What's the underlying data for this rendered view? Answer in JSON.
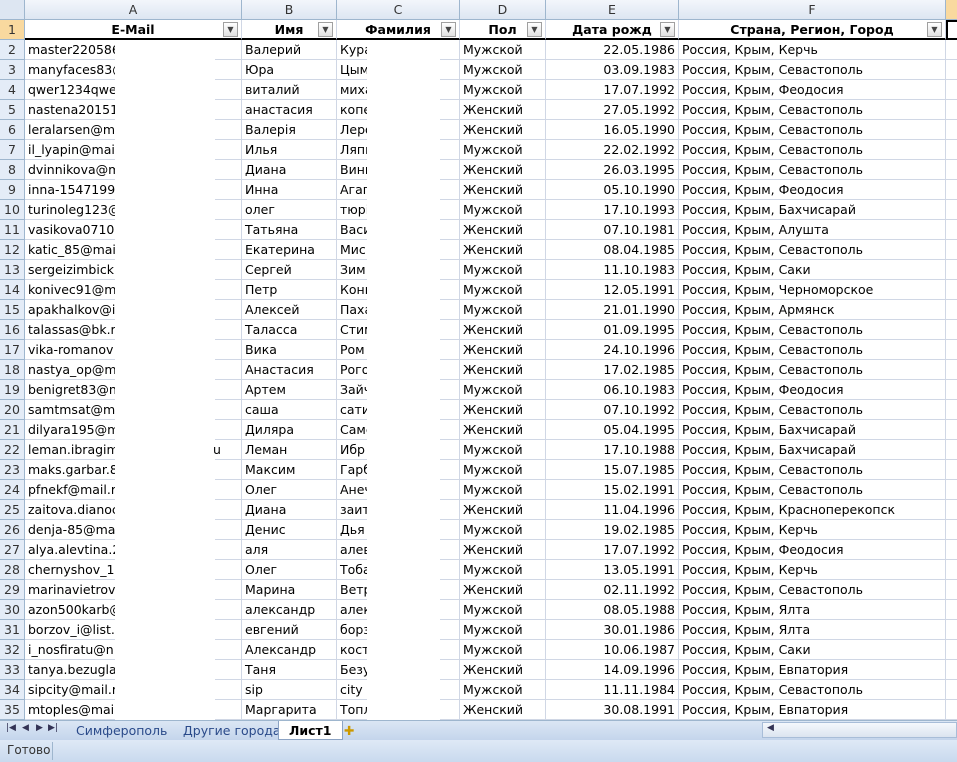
{
  "columns": [
    "A",
    "B",
    "C",
    "D",
    "E",
    "F"
  ],
  "headers": {
    "email": "E-Mail",
    "name": "Имя",
    "surname": "Фамилия",
    "gender": "Пол",
    "birth": "Дата рожд",
    "location": "Страна, Регион, Город"
  },
  "rows": [
    [
      "2",
      "master220586",
      "Валерий",
      "Кура",
      "Мужской",
      "22.05.1986",
      "Россия, Крым, Керчь"
    ],
    [
      "3",
      "manyfaces83@",
      "Юра",
      "Цым",
      "Мужской",
      "03.09.1983",
      "Россия, Крым, Севастополь"
    ],
    [
      "4",
      "qwer1234qwe",
      "виталий",
      "миха",
      "Мужской",
      "17.07.1992",
      "Россия, Крым, Феодосия"
    ],
    [
      "5",
      "nastena20151",
      "анастасия",
      "копе",
      "Женский",
      "27.05.1992",
      "Россия, Крым, Севастополь"
    ],
    [
      "6",
      "leralarsen@m",
      "Валерія",
      "Леро",
      "Женский",
      "16.05.1990",
      "Россия, Крым, Севастополь"
    ],
    [
      "7",
      "il_lyapin@mai",
      "Илья",
      "Ляпи",
      "Мужской",
      "22.02.1992",
      "Россия, Крым, Севастополь"
    ],
    [
      "8",
      "dvinnikova@m",
      "Диана",
      "Винн",
      "Женский",
      "26.03.1995",
      "Россия, Крым, Севастополь"
    ],
    [
      "9",
      "inna-15471990",
      "Инна",
      "Агап",
      "Женский",
      "05.10.1990",
      "Россия, Крым, Феодосия"
    ],
    [
      "10",
      "turinoleg123@",
      "олег",
      "тюрі",
      "Мужской",
      "17.10.1993",
      "Россия, Крым, Бахчисарай"
    ],
    [
      "11",
      "vasikova07108",
      "Татьяна",
      "Васи",
      "Женский",
      "07.10.1981",
      "Россия, Крым, Алушта"
    ],
    [
      "12",
      "katic_85@mai",
      "Екатерина",
      "Мис",
      "Женский",
      "08.04.1985",
      "Россия, Крым, Севастополь"
    ],
    [
      "13",
      "sergeizimbicki",
      "Сергей",
      "Зим",
      "Мужской",
      "11.10.1983",
      "Россия, Крым, Саки"
    ],
    [
      "14",
      "konivec91@m",
      "Петр",
      "Кони",
      "Мужской",
      "12.05.1991",
      "Россия, Крым, Черноморское"
    ],
    [
      "15",
      "apakhalkov@i",
      "Алексей",
      "Паха",
      "Мужской",
      "21.01.1990",
      "Россия, Крым, Армянск"
    ],
    [
      "16",
      "talassas@bk.r",
      "Таласса",
      "Стим",
      "Женский",
      "01.09.1995",
      "Россия, Крым, Севастополь"
    ],
    [
      "17",
      "vika-romanov",
      "Вика",
      "Ром",
      "Женский",
      "24.10.1996",
      "Россия, Крым, Севастополь"
    ],
    [
      "18",
      "nastya_op@m",
      "Анастасия",
      "Рого",
      "Женский",
      "17.02.1985",
      "Россия, Крым, Севастополь"
    ],
    [
      "19",
      "benigret83@n",
      "Артем",
      "Зайч",
      "Мужской",
      "06.10.1983",
      "Россия, Крым, Феодосия"
    ],
    [
      "20",
      "samtmsat@m",
      "саша",
      "сати",
      "Женский",
      "07.10.1992",
      "Россия, Крым, Севастополь"
    ],
    [
      "21",
      "dilyara195@m",
      "Диляра",
      "Саме",
      "Женский",
      "05.04.1995",
      "Россия, Крым, Бахчисарай"
    ],
    [
      "22",
      "leman.ibragim",
      "Леман",
      "Ибр",
      "Мужской",
      "17.10.1988",
      "Россия, Крым, Бахчисарай"
    ],
    [
      "23",
      "maks.garbar.8",
      "Максим",
      "Гарб",
      "Мужской",
      "15.07.1985",
      "Россия, Крым, Севастополь"
    ],
    [
      "24",
      "pfnekf@mail.r",
      "Олег",
      "Анеч",
      "Мужской",
      "15.02.1991",
      "Россия, Крым, Севастополь"
    ],
    [
      "25",
      "zaitova.dianoc",
      "Диана",
      "заит",
      "Женский",
      "11.04.1996",
      "Россия, Крым, Красноперекопск"
    ],
    [
      "26",
      "denja-85@ma",
      "Денис",
      "Дья",
      "Мужской",
      "19.02.1985",
      "Россия, Крым, Керчь"
    ],
    [
      "27",
      "alya.alevtina.2",
      "аля",
      "алев",
      "Женский",
      "17.07.1992",
      "Россия, Крым, Феодосия"
    ],
    [
      "28",
      "chernyshov_1",
      "Олег",
      "Тоба",
      "Мужской",
      "13.05.1991",
      "Россия, Крым, Керчь"
    ],
    [
      "29",
      "marinavietrov",
      "Марина",
      "Ветр",
      "Женский",
      "02.11.1992",
      "Россия, Крым, Севастополь"
    ],
    [
      "30",
      "azon500karb@",
      "александр",
      "алек",
      "Мужской",
      "08.05.1988",
      "Россия, Крым, Ялта"
    ],
    [
      "31",
      "borzov_i@list.",
      "евгений",
      "борз",
      "Мужской",
      "30.01.1986",
      "Россия, Крым, Ялта"
    ],
    [
      "32",
      "i_nosfiratu@n",
      "Александр",
      "кост",
      "Мужской",
      "10.06.1987",
      "Россия, Крым, Саки"
    ],
    [
      "33",
      "tanya.bezugla",
      "Таня",
      "Безу",
      "Женский",
      "14.09.1996",
      "Россия, Крым, Евпатория"
    ],
    [
      "34",
      "sipcity@mail.r",
      "sip",
      "city",
      "Мужской",
      "11.11.1984",
      "Россия, Крым, Севастополь"
    ],
    [
      "35",
      "mtoples@mai",
      "Маргарита",
      "Топл",
      "Женский",
      "30.08.1991",
      "Россия, Крым, Евпатория"
    ]
  ],
  "row22_fragment": "u",
  "header_row_number": "1",
  "sheet_tabs": [
    "Симферополь",
    "Другие города",
    "Лист1"
  ],
  "active_tab": "Лист1",
  "status": "Готово",
  "icons": {
    "filter": "dropdown-arrow-icon",
    "new_sheet": "insert-sheet-icon"
  }
}
